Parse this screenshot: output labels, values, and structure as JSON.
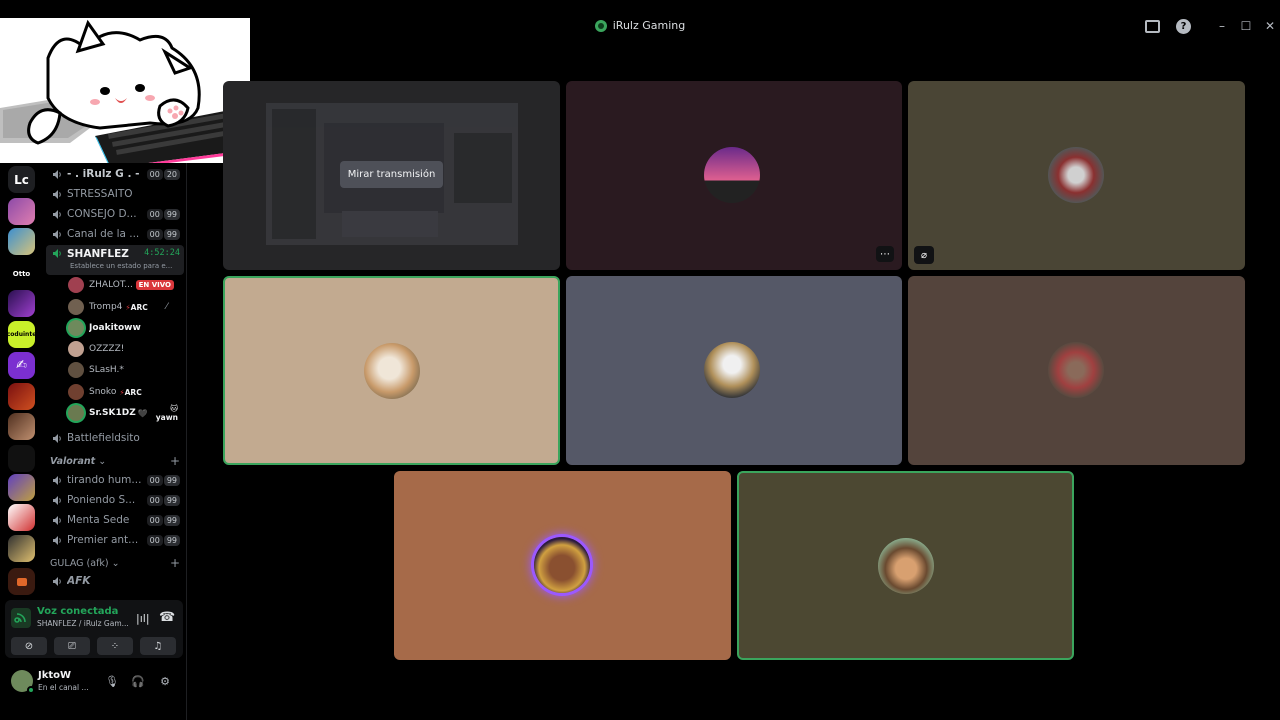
{
  "window": {
    "title": "iRulz Gaming",
    "controls": {
      "minimize": "–",
      "maximize": "☐",
      "close": "✕"
    }
  },
  "server": {
    "name": "iRulz",
    "rail": [
      {
        "label": "Lc"
      },
      {
        "label": ""
      },
      {
        "label": ""
      },
      {
        "label": "Otto"
      },
      {
        "label": ""
      },
      {
        "label": "coduinte"
      },
      {
        "label": ""
      },
      {
        "label": ""
      },
      {
        "label": ""
      },
      {
        "label": ""
      },
      {
        "label": ""
      },
      {
        "label": ""
      },
      {
        "label": ""
      }
    ]
  },
  "channels": [
    {
      "name": "- . iRulz G . -",
      "count_a": "00",
      "count_b": "20"
    },
    {
      "name": "STRESSAITO"
    },
    {
      "name": "CONSEJO D...",
      "count_a": "00",
      "count_b": "99"
    },
    {
      "name": "Canal de la ...",
      "count_a": "00",
      "count_b": "99"
    },
    {
      "name": "SHANFLEZ",
      "timer": "4:52:24",
      "status": "Establece un estado para e...",
      "active": true
    }
  ],
  "voice_users": [
    {
      "name": "ZHALOT...",
      "badge": "EN VIVO"
    },
    {
      "name": "Tromp4",
      "tag": "ARC"
    },
    {
      "name": "Joakitoww"
    },
    {
      "name": "OZZZZ!"
    },
    {
      "name": "SLasH.*"
    },
    {
      "name": "Snoko",
      "tag": "ARC"
    },
    {
      "name": "Sr.SK1DZ",
      "tag": "yawn"
    }
  ],
  "channels_after": [
    {
      "name": "Battlefieldsito"
    }
  ],
  "category_valorant": {
    "label": "Valorant",
    "channels": [
      {
        "name": "tirando hum...",
        "count_a": "00",
        "count_b": "99"
      },
      {
        "name": "Poniendo S...",
        "count_a": "00",
        "count_b": "99"
      },
      {
        "name": "Menta Sede",
        "count_a": "00",
        "count_b": "99"
      },
      {
        "name": "Premier ant...",
        "count_a": "00",
        "count_b": "99"
      }
    ]
  },
  "category_gulag": {
    "label": "GULAG (afk)",
    "channels": [
      {
        "name": "AFK"
      }
    ]
  },
  "voice_panel": {
    "title": "Voz conectada",
    "subtitle": "SHANFLEZ / iRulz Gam..."
  },
  "user_panel": {
    "name": "JktoW",
    "status": "En el canal ..."
  },
  "stream_tile": {
    "button": "Mirar transmisión"
  },
  "tiles": [
    {
      "bg": "#2a1a20"
    },
    {
      "bg": "#4a4535"
    },
    {
      "bg": "#c2aa90",
      "speaking": true
    },
    {
      "bg": "#555867"
    },
    {
      "bg": "#54443c"
    },
    {
      "bg": "#a66a49"
    },
    {
      "bg": "#4c4832",
      "speaking": true
    }
  ],
  "colors": {
    "accent_green": "#3ba55d",
    "live_red": "#da373c"
  }
}
